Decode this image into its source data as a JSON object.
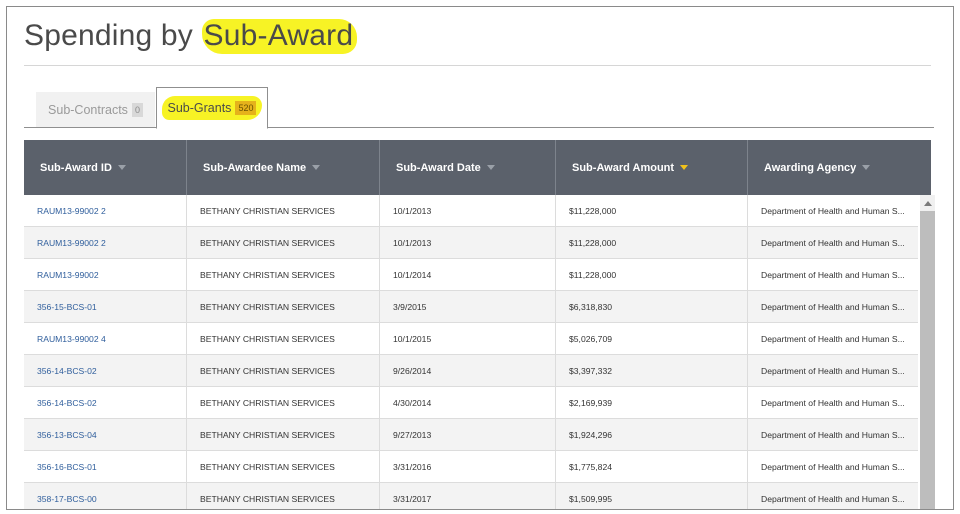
{
  "title": {
    "prefix": "Spending by ",
    "highlight": "Sub-Award"
  },
  "tabs": [
    {
      "label": "Sub-Contracts",
      "count": "0"
    },
    {
      "label": "Sub-Grants",
      "count": "520"
    }
  ],
  "table": {
    "columns": [
      {
        "label": "Sub-Award ID"
      },
      {
        "label": "Sub-Awardee Name"
      },
      {
        "label": "Sub-Award Date"
      },
      {
        "label": "Sub-Award Amount"
      },
      {
        "label": "Awarding Agency"
      }
    ],
    "rows": [
      [
        "RAUM13-99002 2",
        "BETHANY CHRISTIAN SERVICES",
        "10/1/2013",
        "$11,228,000",
        "Department of Health and Human S..."
      ],
      [
        "RAUM13-99002 2",
        "BETHANY CHRISTIAN SERVICES",
        "10/1/2013",
        "$11,228,000",
        "Department of Health and Human S..."
      ],
      [
        "RAUM13-99002",
        "BETHANY CHRISTIAN SERVICES",
        "10/1/2014",
        "$11,228,000",
        "Department of Health and Human S..."
      ],
      [
        "356-15-BCS-01",
        "BETHANY CHRISTIAN SERVICES",
        "3/9/2015",
        "$6,318,830",
        "Department of Health and Human S..."
      ],
      [
        "RAUM13-99002 4",
        "BETHANY CHRISTIAN SERVICES",
        "10/1/2015",
        "$5,026,709",
        "Department of Health and Human S..."
      ],
      [
        "356-14-BCS-02",
        "BETHANY CHRISTIAN SERVICES",
        "9/26/2014",
        "$3,397,332",
        "Department of Health and Human S..."
      ],
      [
        "356-14-BCS-02",
        "BETHANY CHRISTIAN SERVICES",
        "4/30/2014",
        "$2,169,939",
        "Department of Health and Human S..."
      ],
      [
        "356-13-BCS-04",
        "BETHANY CHRISTIAN SERVICES",
        "9/27/2013",
        "$1,924,296",
        "Department of Health and Human S..."
      ],
      [
        "356-16-BCS-01",
        "BETHANY CHRISTIAN SERVICES",
        "3/31/2016",
        "$1,775,824",
        "Department of Health and Human S..."
      ],
      [
        "358-17-BCS-00",
        "BETHANY CHRISTIAN SERVICES",
        "3/31/2017",
        "$1,509,995",
        "Department of Health and Human S..."
      ]
    ]
  },
  "colors": {
    "header_bg": "#5b616b",
    "highlight": "#f7f325",
    "link": "#2f5e9c",
    "active_sort": "#f1c21b"
  }
}
